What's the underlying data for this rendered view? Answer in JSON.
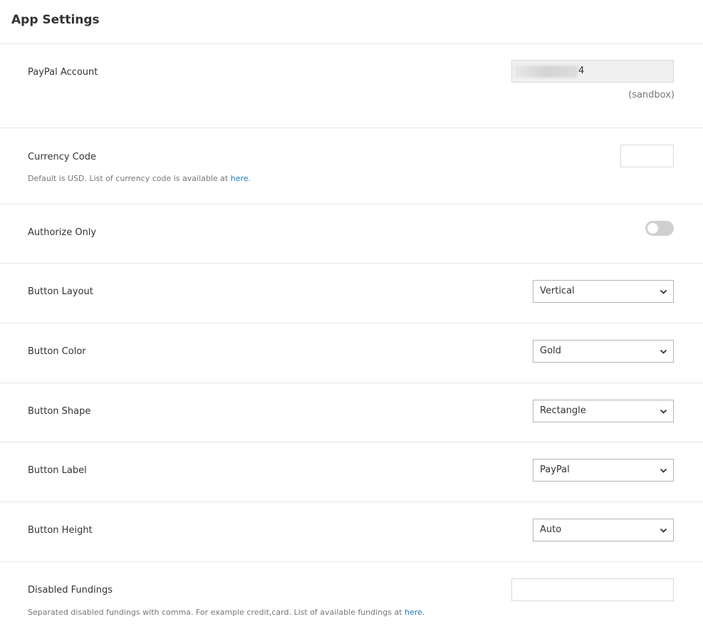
{
  "page": {
    "title": "App Settings"
  },
  "paypal_account": {
    "label": "PayPal Account",
    "value_suffix": "4",
    "environment_note": "(sandbox)"
  },
  "currency_code": {
    "label": "Currency Code",
    "value": "",
    "help_text": "Default is USD. List of currency code is available at",
    "help_link": "here",
    "help_suffix": "."
  },
  "authorize_only": {
    "label": "Authorize Only",
    "enabled": false
  },
  "button_layout": {
    "label": "Button Layout",
    "selected": "Vertical"
  },
  "button_color": {
    "label": "Button Color",
    "selected": "Gold"
  },
  "button_shape": {
    "label": "Button Shape",
    "selected": "Rectangle"
  },
  "button_label": {
    "label": "Button Label",
    "selected": "PayPal"
  },
  "button_height": {
    "label": "Button Height",
    "selected": "Auto"
  },
  "disabled_fundings": {
    "label": "Disabled Fundings",
    "value": "",
    "help_text": "Separated disabled fundings with comma. For example credit,card. List of available fundings at",
    "help_link": "here",
    "help_suffix": "."
  },
  "colors": {
    "link": "#1a7bbf",
    "border": "#e6e6e6",
    "toggle_off": "#cfcfcf",
    "readonly_bg": "#f0f0f0"
  },
  "icons": {
    "select_arrow": "chevron-down-icon"
  }
}
